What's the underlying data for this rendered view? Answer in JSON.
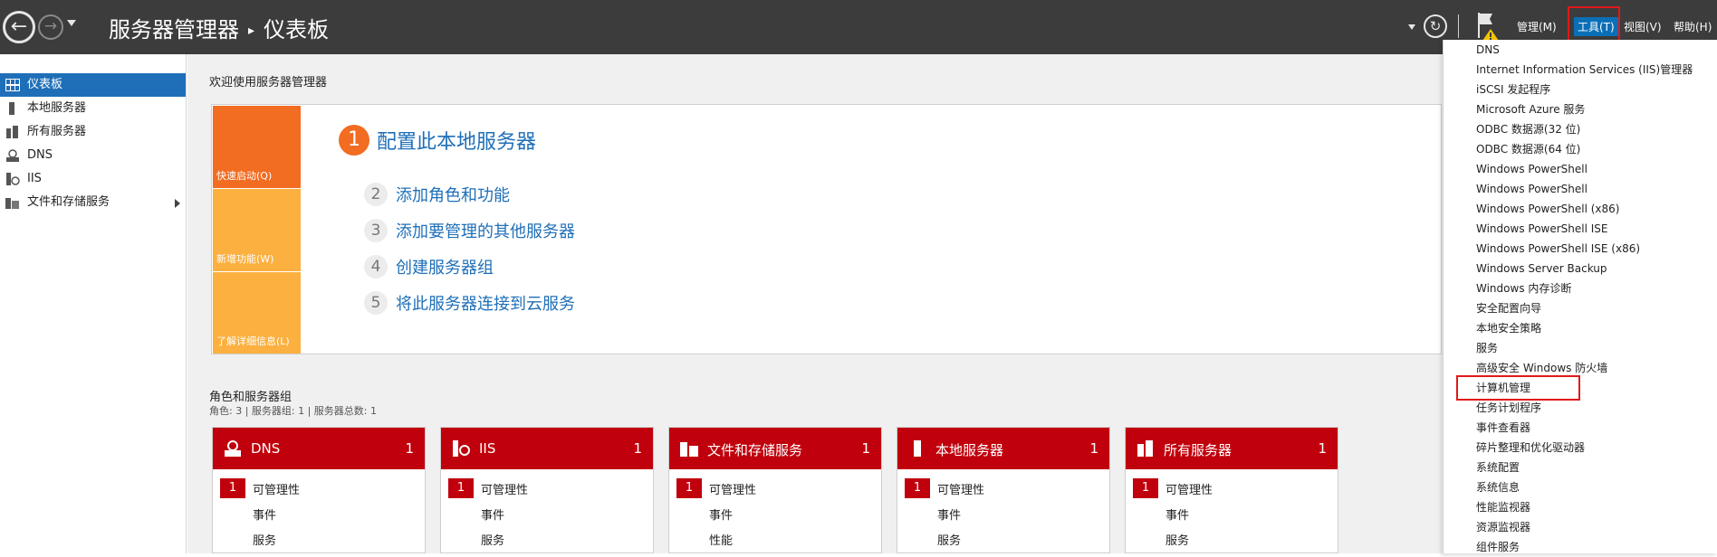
{
  "title_bar": {
    "app": "服务器管理器",
    "separator": "▸",
    "page": "仪表板",
    "menu": {
      "manage": "管理(M)",
      "tools": "工具(T)",
      "view": "视图(V)",
      "help": "帮助(H)"
    }
  },
  "sidebar": {
    "items": [
      {
        "label": "仪表板",
        "icon": "dashboard-icon"
      },
      {
        "label": "本地服务器",
        "icon": "server-icon"
      },
      {
        "label": "所有服务器",
        "icon": "servers-icon"
      },
      {
        "label": "DNS",
        "icon": "dns-icon"
      },
      {
        "label": "IIS",
        "icon": "iis-icon"
      },
      {
        "label": "文件和存储服务",
        "icon": "folder-icon"
      }
    ]
  },
  "welcome": {
    "title": "欢迎使用服务器管理器",
    "tiles": [
      "快速启动(Q)",
      "新增功能(W)",
      "了解详细信息(L)"
    ],
    "steps": [
      {
        "num": "1",
        "label": "配置此本地服务器"
      },
      {
        "num": "2",
        "label": "添加角色和功能"
      },
      {
        "num": "3",
        "label": "添加要管理的其他服务器"
      },
      {
        "num": "4",
        "label": "创建服务器组"
      },
      {
        "num": "5",
        "label": "将此服务器连接到云服务"
      }
    ]
  },
  "roles": {
    "title": "角色和服务器组",
    "subtitle": "角色: 3 | 服务器组: 1 | 服务器总数: 1",
    "cards": [
      {
        "title": "DNS",
        "count": "1",
        "badge": "1",
        "rows": [
          "可管理性",
          "事件",
          "服务"
        ]
      },
      {
        "title": "IIS",
        "count": "1",
        "badge": "1",
        "rows": [
          "可管理性",
          "事件",
          "服务"
        ]
      },
      {
        "title": "文件和存储服务",
        "count": "1",
        "badge": "1",
        "rows": [
          "可管理性",
          "事件",
          "性能"
        ]
      },
      {
        "title": "本地服务器",
        "count": "1",
        "badge": "1",
        "rows": [
          "可管理性",
          "事件",
          "服务"
        ]
      },
      {
        "title": "所有服务器",
        "count": "1",
        "badge": "1",
        "rows": [
          "可管理性",
          "事件",
          "服务"
        ]
      }
    ]
  },
  "tools_menu": {
    "items": [
      "DNS",
      "Internet Information Services (IIS)管理器",
      "iSCSI 发起程序",
      "Microsoft Azure 服务",
      "ODBC 数据源(32 位)",
      "ODBC 数据源(64 位)",
      "Windows PowerShell",
      "Windows PowerShell",
      "Windows PowerShell (x86)",
      "Windows PowerShell ISE",
      "Windows PowerShell ISE (x86)",
      "Windows Server Backup",
      "Windows 内存诊断",
      "安全配置向导",
      "本地安全策略",
      "服务",
      "高级安全 Windows 防火墙",
      "计算机管理",
      "任务计划程序",
      "事件查看器",
      "碎片整理和优化驱动器",
      "系统配置",
      "系统信息",
      "性能监视器",
      "资源监视器",
      "组件服务"
    ],
    "highlighted": "计算机管理"
  },
  "colors": {
    "titlebar": "#3c3c3c",
    "accent_blue": "#1f6fb8",
    "orange": "#f26c21",
    "amber": "#fbb040",
    "card_red": "#c0000c",
    "highlight_red": "#e11919"
  }
}
